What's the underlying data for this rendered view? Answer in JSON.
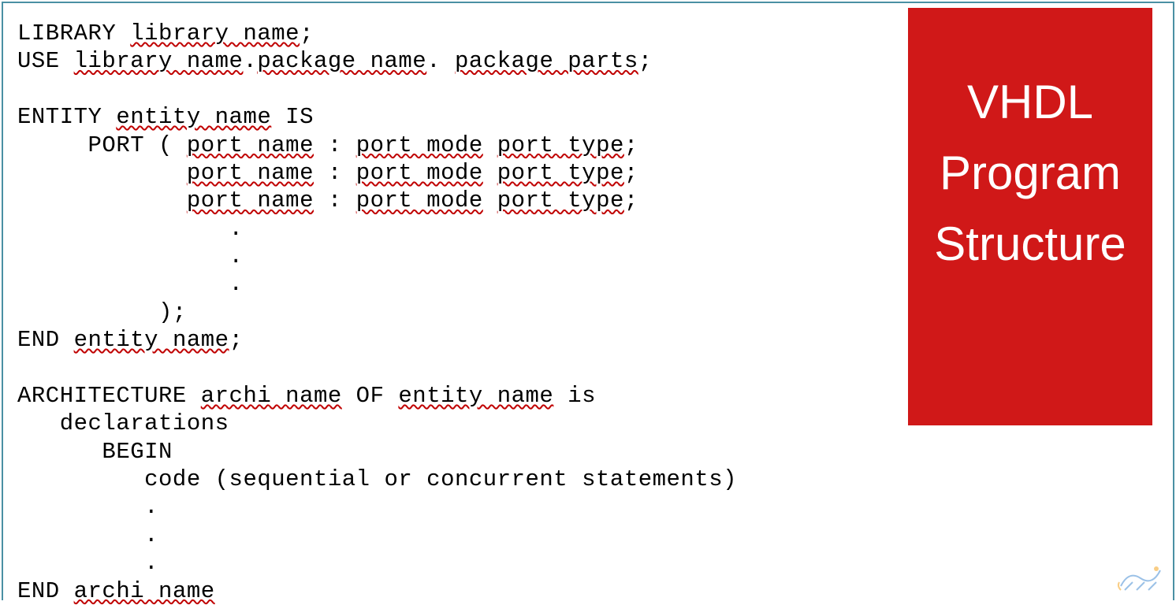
{
  "title": {
    "line1": "VHDL",
    "line2": "Program",
    "line3": "Structure"
  },
  "code": {
    "l1_kw": "LIBRARY ",
    "l1_sq": "library name",
    "l1_end": ";",
    "l2_kw": "USE ",
    "l2_sq1": "library name",
    "l2_dot1": ".",
    "l2_sq2": "package name",
    "l2_dot2": ". ",
    "l2_sq3": "package parts",
    "l2_end": ";",
    "l4_kw": "ENTITY ",
    "l4_sq": "entity name",
    "l4_end": " IS",
    "l5_pre": "     PORT ( ",
    "l5_sq1": "port name",
    "l5_mid1": " : ",
    "l5_sq2": "port mode",
    "l5_sp": " ",
    "l5_sq3": "port type",
    "l5_end": ";",
    "l6_pre": "            ",
    "l6_sq1": "port name",
    "l6_mid1": " : ",
    "l6_sq2": "port mode",
    "l6_sp": " ",
    "l6_sq3": "port type",
    "l6_end": ";",
    "l7_pre": "            ",
    "l7_sq1": "port name",
    "l7_mid1": " : ",
    "l7_sq2": "port mode",
    "l7_sp": " ",
    "l7_sq3": "port type",
    "l7_end": ";",
    "l8": "               .",
    "l9": "               .",
    "l10": "               .",
    "l11": "          );",
    "l12_kw": "END ",
    "l12_sq": "entity name",
    "l12_end": ";",
    "l14_kw": "ARCHITECTURE ",
    "l14_sq1": "archi name",
    "l14_mid": " OF ",
    "l14_sq2": "entity name",
    "l14_end": " is",
    "l15": "   declarations",
    "l16": "      BEGIN",
    "l17": "         code (sequential or concurrent statements)",
    "l18": "         .",
    "l19": "         .",
    "l20": "         .",
    "l21_kw": "END ",
    "l21_sq": "archi name"
  }
}
